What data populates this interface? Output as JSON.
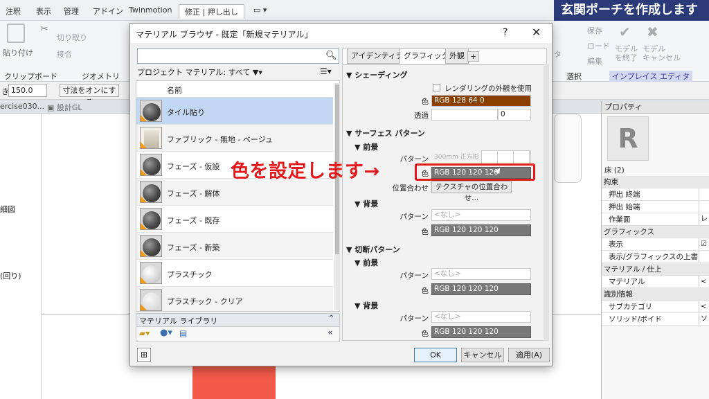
{
  "ribbon": {
    "tabs": [
      "注釈",
      "表示",
      "管理",
      "アドイン",
      "Twinmotion",
      "修正 | 押し出し"
    ],
    "title_banner": "玄関ポーチを作成します",
    "groups": {
      "clipboard": {
        "paste": "貼り付け",
        "title": "クリップボード"
      },
      "geometry": {
        "cut": "切り取り",
        "join": "接合",
        "title": "ジオメトリ"
      },
      "select_title": "選択",
      "inplace": {
        "save": "保存",
        "load": "ロード",
        "edit": "編集",
        "finish": "モデル\nを終了",
        "cancel": "モデル\nキャンセル",
        "title": "インプレイス エディタ"
      }
    },
    "partial_label": "タ"
  },
  "optbar": {
    "depth_label": "き",
    "depth_value": "150.0",
    "dim_button": "寸法をオンにする"
  },
  "doc_tabs": {
    "tab1": "ercise030...",
    "tab2": "設計GL"
  },
  "left_panel": {
    "item1": "細図",
    "item2": "(回り)"
  },
  "properties": {
    "title": "プロパティ",
    "type": "床 (2)",
    "rows": [
      {
        "label": "拘束",
        "cat": true
      },
      {
        "label": "押出 終端",
        "cat": false,
        "val": ""
      },
      {
        "label": "押出 始端",
        "cat": false,
        "val": ""
      },
      {
        "label": "作業面",
        "cat": false,
        "val": "レベ"
      },
      {
        "label": "グラフィックス",
        "cat": true
      },
      {
        "label": "表示",
        "cat": false,
        "val": "☑"
      },
      {
        "label": "表示/グラフィックスの上書き",
        "cat": false,
        "val": ""
      },
      {
        "label": "マテリアル / 仕上",
        "cat": true
      },
      {
        "label": "マテリアル",
        "cat": false,
        "val": "<カ"
      },
      {
        "label": "識別情報",
        "cat": true
      },
      {
        "label": "サブカテゴリ",
        "cat": false,
        "val": "<な"
      },
      {
        "label": "ソリッド/ボイド",
        "cat": false,
        "val": "ソリ"
      }
    ]
  },
  "dialog": {
    "title": "マテリアル ブラウザ - 既定「新規マテリアル」",
    "help": "?",
    "close": "✕",
    "search_placeholder": "",
    "project_filter": "プロジェクト マテリアル: すべて",
    "list_header": "名前",
    "materials": [
      {
        "name": "タイル貼り",
        "selected": true,
        "sphere": "dark"
      },
      {
        "name": "ファブリック - 無地 - ベージュ",
        "selected": false,
        "sphere": "cloth"
      },
      {
        "name": "フェーズ - 仮設",
        "selected": false,
        "sphere": "dark"
      },
      {
        "name": "フェーズ - 解体",
        "selected": false,
        "sphere": "dark"
      },
      {
        "name": "フェーズ - 既存",
        "selected": false,
        "sphere": "dark"
      },
      {
        "name": "フェーズ - 新築",
        "selected": false,
        "sphere": "dark"
      },
      {
        "name": "プラスチック",
        "selected": false,
        "sphere": "light"
      },
      {
        "name": "プラスチック - クリア",
        "selected": false,
        "sphere": "clear"
      }
    ],
    "library_label": "マテリアル ライブラリ",
    "editor_tabs": [
      "アイデンティティ",
      "グラフィックス",
      "外観",
      "+"
    ],
    "shading": {
      "title": "シェーディング",
      "use_render_label": "レンダリングの外観を使用",
      "color_label": "色",
      "color_value": "RGB 128 64 0",
      "color_hex": "#8b4000",
      "transparency_label": "透過",
      "transparency_value": "0"
    },
    "surface": {
      "title": "サーフェス パターン",
      "fg_title": "前景",
      "fg_pattern_label": "パターン",
      "fg_pattern_value": "300mm 正方形",
      "fg_color_label": "色",
      "fg_color_value": "RGB 120 120 120",
      "align_label": "位置合わせ",
      "align_button": "テクスチャの位置合わせ...",
      "bg_title": "背景",
      "bg_pattern_label": "パターン",
      "bg_pattern_value": "<なし>",
      "bg_color_label": "色",
      "bg_color_value": "RGB 120 120 120"
    },
    "cut": {
      "title": "切断パターン",
      "fg_title": "前景",
      "fg_pattern_label": "パターン",
      "fg_pattern_value": "<なし>",
      "fg_color_label": "色",
      "fg_color_value": "RGB 120 120 120",
      "bg_title": "背景",
      "bg_pattern_label": "パターン",
      "bg_pattern_value": "<なし>",
      "bg_color_label": "色",
      "bg_color_value": "RGB 120 120 120"
    },
    "buttons": {
      "ok": "OK",
      "cancel": "キャンセル",
      "apply": "適用(A)"
    }
  },
  "annotation": {
    "text": "色を設定します→",
    "color": "#e3191c"
  }
}
